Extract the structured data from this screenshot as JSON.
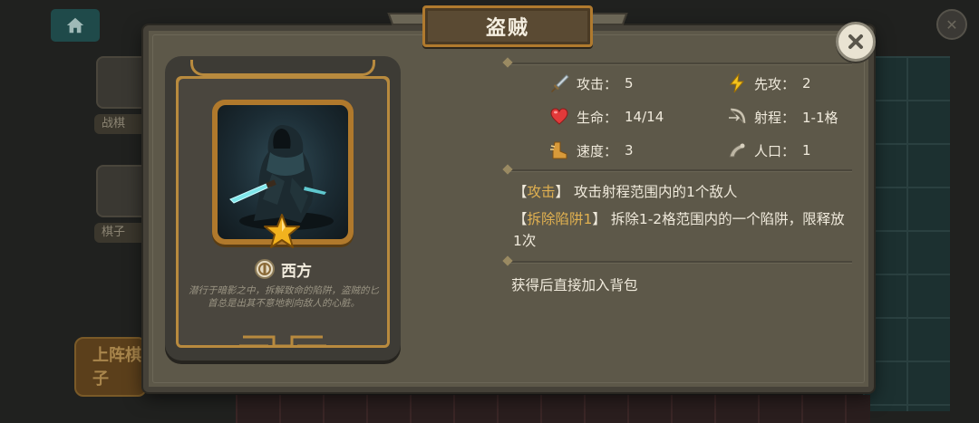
{
  "background": {
    "slot_label_1": "战棋",
    "slot_label_2": "棋子",
    "deploy_button": "上阵棋子"
  },
  "dialog": {
    "title": "盗贼",
    "close_icon": "close-icon"
  },
  "card": {
    "rarity_stars": 1,
    "faction": "西方",
    "flavor": "潜行于暗影之中，拆解致命的陷阱，盗贼的匕首总是出其不意地刺向敌人的心脏。"
  },
  "stats": [
    {
      "label": "攻击：",
      "value": "5",
      "icon": "sword-icon"
    },
    {
      "label": "先攻：",
      "value": "2",
      "icon": "lightning-icon"
    },
    {
      "label": "生命：",
      "value": "14/14",
      "icon": "heart-icon"
    },
    {
      "label": "射程：",
      "value": "1-1格",
      "icon": "bow-icon"
    },
    {
      "label": "速度：",
      "value": "3",
      "icon": "boot-icon"
    },
    {
      "label": "人口：",
      "value": "1",
      "icon": "population-icon"
    }
  ],
  "abilities": [
    {
      "open": "【",
      "tag": "攻击",
      "close": "】",
      "text": "攻击射程范围内的1个敌人"
    },
    {
      "open": "【",
      "tag": "拆除陷阱1",
      "close": "】",
      "text": "拆除1-2格范围内的一个陷阱，限释放1次"
    }
  ],
  "obtain_note": "获得后直接加入背包",
  "colors": {
    "panel": "#5d5849",
    "gold": "#b88a3e",
    "ability_tag": "#e0b050",
    "text": "#f0eadc"
  }
}
